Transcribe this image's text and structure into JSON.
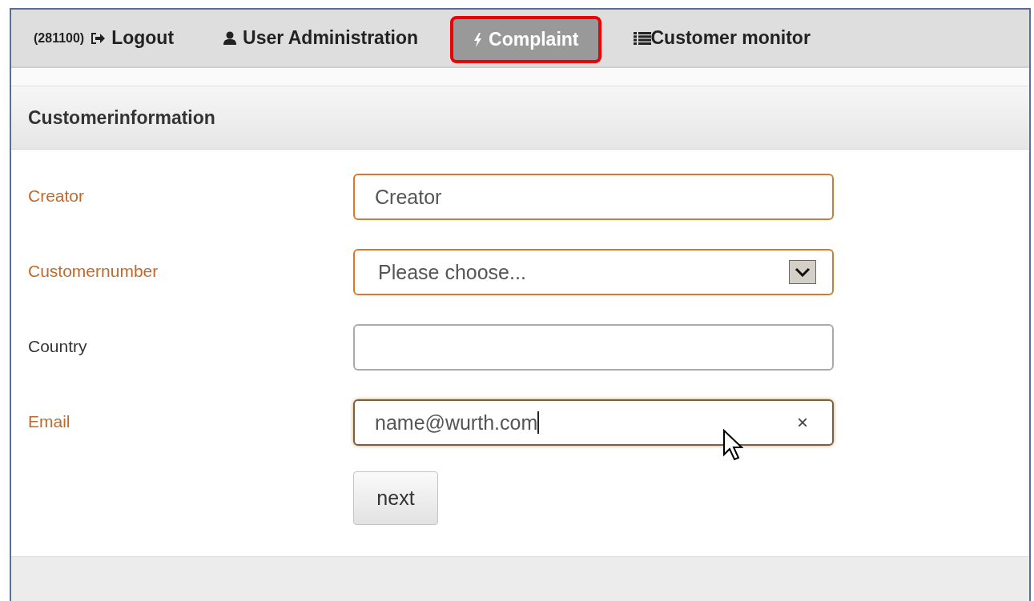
{
  "nav": [
    {
      "prefix": "(281100)",
      "kind": "logout",
      "label": "Logout",
      "selected": false
    },
    {
      "kind": "user",
      "label": "User Administration",
      "selected": false
    },
    {
      "kind": "bolt",
      "label": "Complaint",
      "selected": true
    },
    {
      "kind": "list",
      "label": "Customer monitor",
      "selected": false
    }
  ],
  "section": {
    "title": "Customerinformation"
  },
  "fields": [
    {
      "label": "Creator",
      "kind": "text",
      "required": true,
      "placeholder": "Creator",
      "focused": false
    },
    {
      "label": "Customernumber",
      "kind": "select",
      "required": true,
      "value": "Please choose...",
      "focused": false
    },
    {
      "label": "Country",
      "kind": "text",
      "required": false,
      "focused": false
    },
    {
      "label": "Email",
      "kind": "text",
      "required": true,
      "value": "name@wurth.com",
      "focused": true,
      "clear": "×"
    }
  ],
  "button": {
    "label": "next"
  }
}
